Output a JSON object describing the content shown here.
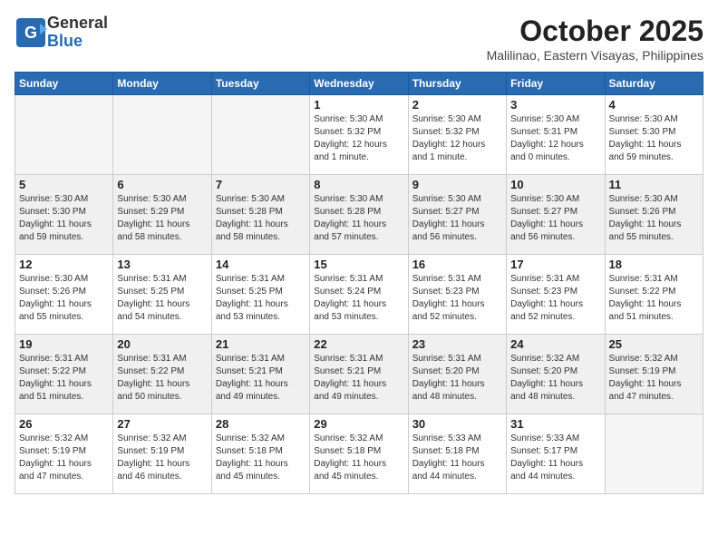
{
  "header": {
    "logo": {
      "line1": "General",
      "line2": "Blue"
    },
    "month": "October 2025",
    "location": "Malilinao, Eastern Visayas, Philippines"
  },
  "weekdays": [
    "Sunday",
    "Monday",
    "Tuesday",
    "Wednesday",
    "Thursday",
    "Friday",
    "Saturday"
  ],
  "weeks": [
    [
      {
        "day": "",
        "info": ""
      },
      {
        "day": "",
        "info": ""
      },
      {
        "day": "",
        "info": ""
      },
      {
        "day": "1",
        "info": "Sunrise: 5:30 AM\nSunset: 5:32 PM\nDaylight: 12 hours\nand 1 minute."
      },
      {
        "day": "2",
        "info": "Sunrise: 5:30 AM\nSunset: 5:32 PM\nDaylight: 12 hours\nand 1 minute."
      },
      {
        "day": "3",
        "info": "Sunrise: 5:30 AM\nSunset: 5:31 PM\nDaylight: 12 hours\nand 0 minutes."
      },
      {
        "day": "4",
        "info": "Sunrise: 5:30 AM\nSunset: 5:30 PM\nDaylight: 11 hours\nand 59 minutes."
      }
    ],
    [
      {
        "day": "5",
        "info": "Sunrise: 5:30 AM\nSunset: 5:30 PM\nDaylight: 11 hours\nand 59 minutes."
      },
      {
        "day": "6",
        "info": "Sunrise: 5:30 AM\nSunset: 5:29 PM\nDaylight: 11 hours\nand 58 minutes."
      },
      {
        "day": "7",
        "info": "Sunrise: 5:30 AM\nSunset: 5:28 PM\nDaylight: 11 hours\nand 58 minutes."
      },
      {
        "day": "8",
        "info": "Sunrise: 5:30 AM\nSunset: 5:28 PM\nDaylight: 11 hours\nand 57 minutes."
      },
      {
        "day": "9",
        "info": "Sunrise: 5:30 AM\nSunset: 5:27 PM\nDaylight: 11 hours\nand 56 minutes."
      },
      {
        "day": "10",
        "info": "Sunrise: 5:30 AM\nSunset: 5:27 PM\nDaylight: 11 hours\nand 56 minutes."
      },
      {
        "day": "11",
        "info": "Sunrise: 5:30 AM\nSunset: 5:26 PM\nDaylight: 11 hours\nand 55 minutes."
      }
    ],
    [
      {
        "day": "12",
        "info": "Sunrise: 5:30 AM\nSunset: 5:26 PM\nDaylight: 11 hours\nand 55 minutes."
      },
      {
        "day": "13",
        "info": "Sunrise: 5:31 AM\nSunset: 5:25 PM\nDaylight: 11 hours\nand 54 minutes."
      },
      {
        "day": "14",
        "info": "Sunrise: 5:31 AM\nSunset: 5:25 PM\nDaylight: 11 hours\nand 53 minutes."
      },
      {
        "day": "15",
        "info": "Sunrise: 5:31 AM\nSunset: 5:24 PM\nDaylight: 11 hours\nand 53 minutes."
      },
      {
        "day": "16",
        "info": "Sunrise: 5:31 AM\nSunset: 5:23 PM\nDaylight: 11 hours\nand 52 minutes."
      },
      {
        "day": "17",
        "info": "Sunrise: 5:31 AM\nSunset: 5:23 PM\nDaylight: 11 hours\nand 52 minutes."
      },
      {
        "day": "18",
        "info": "Sunrise: 5:31 AM\nSunset: 5:22 PM\nDaylight: 11 hours\nand 51 minutes."
      }
    ],
    [
      {
        "day": "19",
        "info": "Sunrise: 5:31 AM\nSunset: 5:22 PM\nDaylight: 11 hours\nand 51 minutes."
      },
      {
        "day": "20",
        "info": "Sunrise: 5:31 AM\nSunset: 5:22 PM\nDaylight: 11 hours\nand 50 minutes."
      },
      {
        "day": "21",
        "info": "Sunrise: 5:31 AM\nSunset: 5:21 PM\nDaylight: 11 hours\nand 49 minutes."
      },
      {
        "day": "22",
        "info": "Sunrise: 5:31 AM\nSunset: 5:21 PM\nDaylight: 11 hours\nand 49 minutes."
      },
      {
        "day": "23",
        "info": "Sunrise: 5:31 AM\nSunset: 5:20 PM\nDaylight: 11 hours\nand 48 minutes."
      },
      {
        "day": "24",
        "info": "Sunrise: 5:32 AM\nSunset: 5:20 PM\nDaylight: 11 hours\nand 48 minutes."
      },
      {
        "day": "25",
        "info": "Sunrise: 5:32 AM\nSunset: 5:19 PM\nDaylight: 11 hours\nand 47 minutes."
      }
    ],
    [
      {
        "day": "26",
        "info": "Sunrise: 5:32 AM\nSunset: 5:19 PM\nDaylight: 11 hours\nand 47 minutes."
      },
      {
        "day": "27",
        "info": "Sunrise: 5:32 AM\nSunset: 5:19 PM\nDaylight: 11 hours\nand 46 minutes."
      },
      {
        "day": "28",
        "info": "Sunrise: 5:32 AM\nSunset: 5:18 PM\nDaylight: 11 hours\nand 45 minutes."
      },
      {
        "day": "29",
        "info": "Sunrise: 5:32 AM\nSunset: 5:18 PM\nDaylight: 11 hours\nand 45 minutes."
      },
      {
        "day": "30",
        "info": "Sunrise: 5:33 AM\nSunset: 5:18 PM\nDaylight: 11 hours\nand 44 minutes."
      },
      {
        "day": "31",
        "info": "Sunrise: 5:33 AM\nSunset: 5:17 PM\nDaylight: 11 hours\nand 44 minutes."
      },
      {
        "day": "",
        "info": ""
      }
    ]
  ]
}
